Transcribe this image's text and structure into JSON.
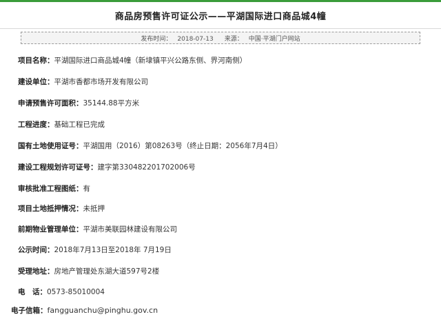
{
  "title": "商品房预售许可证公示——平湖国际进口商品城4幢",
  "meta": {
    "publish_label": "发布时间：",
    "publish_date": "2018-07-13",
    "source_label": "来源：",
    "source": "中国·平湖门户网站"
  },
  "fields": [
    {
      "label": "项目名称：",
      "value": "平湖国际进口商品城4幢（新埭镇平兴公路东侧、界河南侧）"
    },
    {
      "label": "建设单位：",
      "value": "平湖市香都市场开发有限公司"
    },
    {
      "label": "申请预售许可面积：",
      "value": "35144.88平方米"
    },
    {
      "label": "工程进度：",
      "value": "基础工程已完成"
    },
    {
      "label": "国有土地使用证号：",
      "value": "平湖国用（2016）第08263号（终止日期：2056年7月4日）"
    },
    {
      "label": "建设工程规划许可证号：",
      "value": "建字第330482201702006号"
    },
    {
      "label": "审核批准工程图纸：",
      "value": "有"
    },
    {
      "label": "项目土地抵押情况：",
      "value": "未抵押"
    },
    {
      "label": "前期物业管理单位：",
      "value": "平湖市美联园林建设有限公司"
    },
    {
      "label": "公示时间：",
      "value": "2018年7月13日至2018年 7月19日"
    },
    {
      "label": "受理地址：",
      "value": "房地产管理处东湖大道597号2楼"
    },
    {
      "label": "电　话：",
      "value": "0573-85010004"
    },
    {
      "label": "电子信箱：",
      "value": "fangguanchu@pinghu.gov.cn"
    }
  ]
}
